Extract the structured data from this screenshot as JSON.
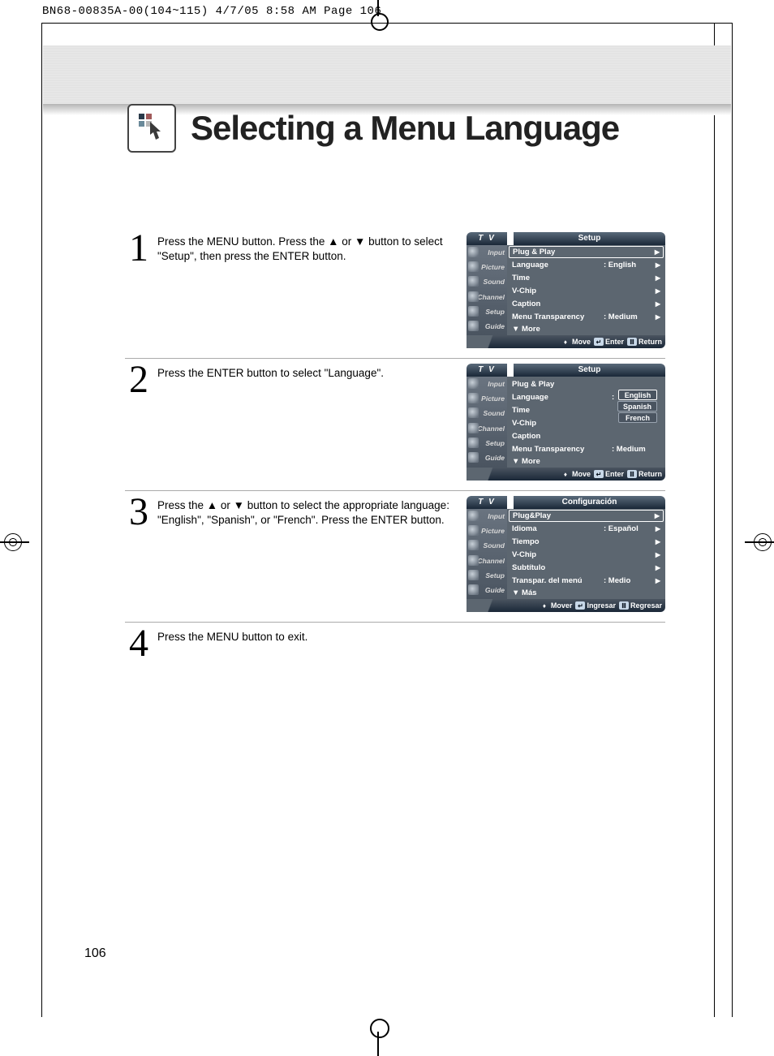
{
  "crop_header": "BN68-00835A-00(104~115)  4/7/05  8:58 AM  Page 106",
  "page_title": "Selecting a Menu Language",
  "page_number": "106",
  "steps": [
    {
      "num": "1",
      "text": "Press the MENU button. Press the ▲ or ▼ button to select \"Setup\", then press the ENTER button.",
      "osd_key": "osd1"
    },
    {
      "num": "2",
      "text": "Press the ENTER button to select \"Language\".",
      "osd_key": "osd2"
    },
    {
      "num": "3",
      "text": "Press the ▲ or ▼ button to select the appropriate language: \"English\", \"Spanish\", or \"French\". Press the ENTER button.",
      "osd_key": "osd3"
    },
    {
      "num": "4",
      "text": "Press the MENU button to exit."
    }
  ],
  "side_items": [
    "Input",
    "Picture",
    "Sound",
    "Channel",
    "Setup",
    "Guide"
  ],
  "osd1": {
    "tv": "T V",
    "title": "Setup",
    "rows": [
      {
        "label": "Plug & Play",
        "val": "",
        "hl": true,
        "arrow": true
      },
      {
        "label": "Language",
        "val": ": English",
        "arrow": true
      },
      {
        "label": "Time",
        "val": "",
        "arrow": true
      },
      {
        "label": "V-Chip",
        "val": "",
        "arrow": true
      },
      {
        "label": "Caption",
        "val": "",
        "arrow": true
      },
      {
        "label": "Menu Transparency",
        "val": ": Medium",
        "arrow": true
      }
    ],
    "more": "▼ More",
    "footer": [
      "Move",
      "Enter",
      "Return"
    ]
  },
  "osd2": {
    "tv": "T V",
    "title": "Setup",
    "rows": [
      {
        "label": "Plug & Play",
        "val": ""
      },
      {
        "label": "Language",
        "val": ":"
      },
      {
        "label": "Time",
        "val": ""
      },
      {
        "label": "V-Chip",
        "val": ""
      },
      {
        "label": "Caption",
        "val": ""
      },
      {
        "label": "Menu Transparency",
        "val": ": Medium"
      }
    ],
    "more": "▼ More",
    "footer": [
      "Move",
      "Enter",
      "Return"
    ],
    "dropdown": [
      "English",
      "Spanish",
      "French"
    ],
    "dropdown_hl_index": 0
  },
  "osd3": {
    "tv": "T V",
    "title": "Configuración",
    "rows": [
      {
        "label": "Plug&Play",
        "val": "",
        "hl": true,
        "arrow": true
      },
      {
        "label": "Idioma",
        "val": ": Español",
        "arrow": true
      },
      {
        "label": "Tiempo",
        "val": "",
        "arrow": true
      },
      {
        "label": "V-Chip",
        "val": "",
        "arrow": true
      },
      {
        "label": "Subtítulo",
        "val": "",
        "arrow": true
      },
      {
        "label": "Transpar. del menú",
        "val": ": Medio",
        "arrow": true
      }
    ],
    "more": "▼ Más",
    "footer": [
      "Mover",
      "Ingresar",
      "Regresar"
    ]
  },
  "footer_icons": [
    "↕",
    "↵",
    "▭"
  ]
}
